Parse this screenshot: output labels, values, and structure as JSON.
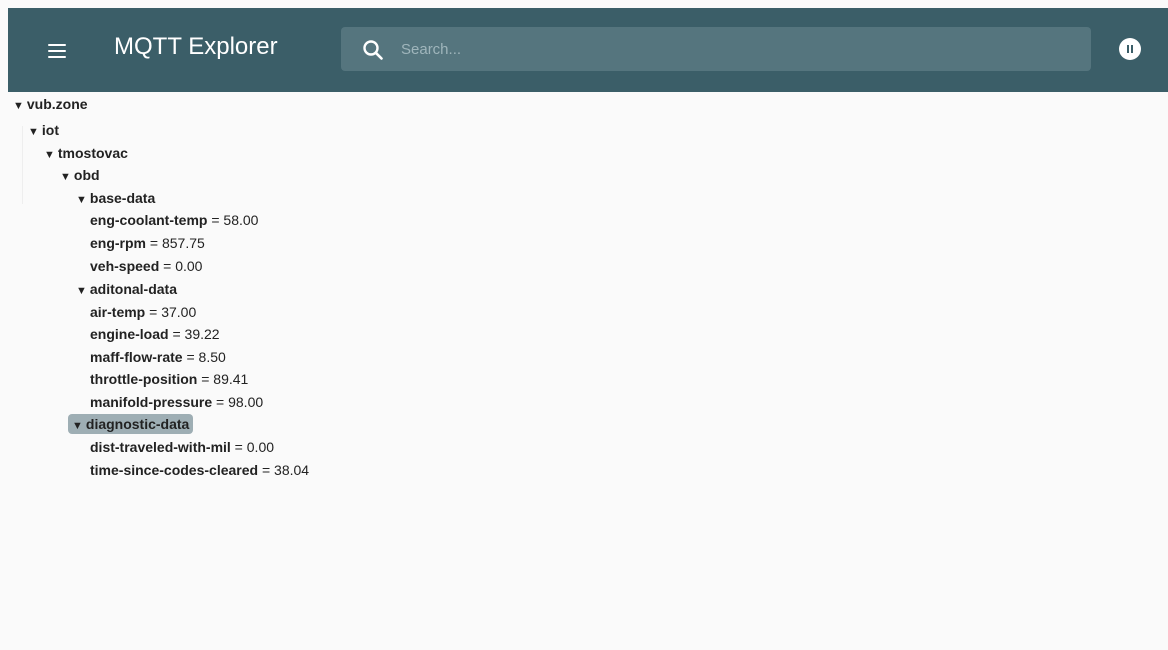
{
  "header": {
    "title": "MQTT Explorer",
    "search_placeholder": "Search..."
  },
  "icons": {
    "menu": "menu-icon",
    "search": "search-icon",
    "pause": "pause-icon"
  },
  "colors": {
    "topbar": "#3b5e68",
    "search_bg": "#55757e",
    "selected_bg": "#9eaeb4"
  },
  "tree": {
    "vub_zone": "vub.zone",
    "iot": "iot",
    "tmostovac": "tmostovac",
    "obd": "obd",
    "base_data": {
      "label": "base-data",
      "items": [
        {
          "key": "eng-coolant-temp",
          "value": "58.00"
        },
        {
          "key": "eng-rpm",
          "value": "857.75"
        },
        {
          "key": "veh-speed",
          "value": "0.00"
        }
      ]
    },
    "aditonal_data": {
      "label": "aditonal-data",
      "items": [
        {
          "key": "air-temp",
          "value": "37.00"
        },
        {
          "key": "engine-load",
          "value": "39.22"
        },
        {
          "key": "maff-flow-rate",
          "value": "8.50"
        },
        {
          "key": "throttle-position",
          "value": "89.41"
        },
        {
          "key": "manifold-pressure",
          "value": "98.00"
        }
      ]
    },
    "diagnostic_data": {
      "label": "diagnostic-data",
      "items": [
        {
          "key": "dist-traveled-with-mil",
          "value": "0.00"
        },
        {
          "key": "time-since-codes-cleared",
          "value": "38.04"
        }
      ]
    },
    "arrow": "▼",
    "separator": " = "
  }
}
